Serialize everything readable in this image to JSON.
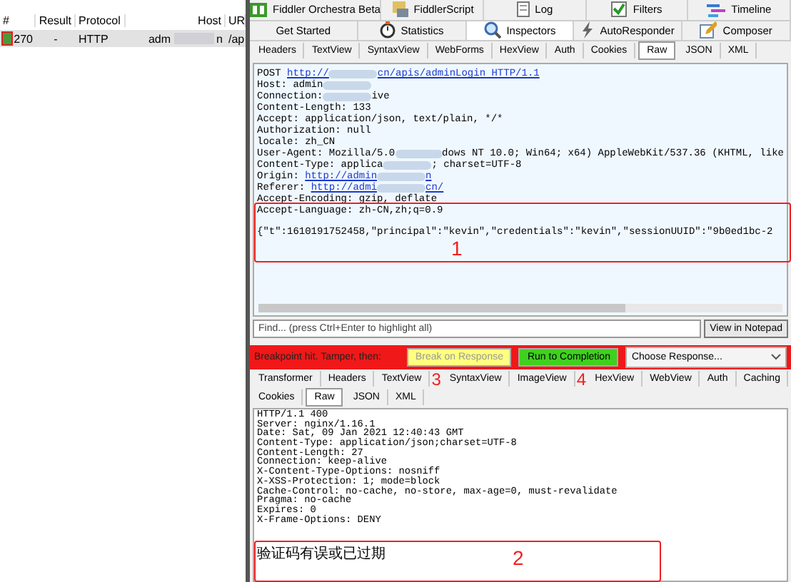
{
  "sessions": {
    "columns": [
      "#",
      "Result",
      "Protocol",
      "Host",
      "UR"
    ],
    "rows": [
      {
        "selected": true,
        "number": "270",
        "result": "-",
        "protocol": "HTTP",
        "host": [
          "adm",
          "n"
        ],
        "url": "/ap"
      }
    ]
  },
  "top_tabs": [
    [
      {
        "label": "Fiddler Orchestra Beta",
        "kind": "badge",
        "selected": false
      },
      {
        "label": "FiddlerScript",
        "kind": "script",
        "selected": false
      },
      {
        "label": "Log",
        "kind": "log",
        "selected": false
      },
      {
        "label": "Filters",
        "kind": "check",
        "selected": false
      },
      {
        "label": "Timeline",
        "kind": "timeline",
        "selected": false
      }
    ],
    [
      {
        "label": "Get Started",
        "kind": "plain",
        "selected": false
      },
      {
        "label": "Statistics",
        "kind": "stopwatch",
        "selected": false
      },
      {
        "label": "Inspectors",
        "kind": "magnifier",
        "selected": true
      },
      {
        "label": "AutoResponder",
        "kind": "bolt",
        "selected": false
      },
      {
        "label": "Composer",
        "kind": "pencil",
        "selected": false
      }
    ]
  ],
  "request_tabs": [
    {
      "label": "Headers",
      "selected": false
    },
    {
      "label": "TextView",
      "selected": false
    },
    {
      "label": "SyntaxView",
      "selected": false
    },
    {
      "label": "WebForms",
      "selected": false
    },
    {
      "label": "HexView",
      "selected": false
    },
    {
      "label": "Auth",
      "selected": false
    },
    {
      "label": "Cookies",
      "selected": false
    },
    {
      "label": "Raw",
      "selected": true
    },
    {
      "label": "JSON",
      "selected": false
    },
    {
      "label": "XML",
      "selected": false
    }
  ],
  "request": {
    "headers": [
      [
        {
          "kind": "text",
          "text": "POST "
        },
        {
          "kind": "link",
          "text": "http://"
        },
        {
          "kind": "redacted"
        },
        {
          "kind": "link",
          "text": "cn/apis/adminLogin HTTP/1.1"
        }
      ],
      [
        {
          "kind": "text",
          "text": "Host: admin"
        },
        {
          "kind": "redacted"
        }
      ],
      [
        {
          "kind": "text",
          "text": "Connection:"
        },
        {
          "kind": "redacted"
        },
        {
          "kind": "text",
          "text": "ive"
        }
      ],
      [
        {
          "kind": "text",
          "text": "Content-Length: 133"
        }
      ],
      [
        {
          "kind": "text",
          "text": "Accept: application/json, text/plain, */*"
        }
      ],
      [
        {
          "kind": "text",
          "text": "Authorization: null"
        }
      ],
      [
        {
          "kind": "text",
          "text": "locale: zh_CN"
        }
      ],
      [
        {
          "kind": "text",
          "text": "User-Agent: Mozilla/5.0"
        },
        {
          "kind": "redacted"
        },
        {
          "kind": "text",
          "text": "dows NT 10.0; Win64; x64) AppleWebKit/537.36 (KHTML, like"
        }
      ],
      [
        {
          "kind": "text",
          "text": "Content-Type: applica"
        },
        {
          "kind": "redacted"
        },
        {
          "kind": "text",
          "text": "; charset=UTF-8"
        }
      ],
      [
        {
          "kind": "text",
          "text": "Origin: "
        },
        {
          "kind": "link",
          "text": "http://admin"
        },
        {
          "kind": "redacted"
        },
        {
          "kind": "link",
          "text": "n"
        }
      ],
      [
        {
          "kind": "text",
          "text": "Referer: "
        },
        {
          "kind": "link",
          "text": "http://admi"
        },
        {
          "kind": "redacted"
        },
        {
          "kind": "link",
          "text": "cn/"
        }
      ],
      [
        {
          "kind": "text",
          "text": "Accept-Encoding: gzip, deflate"
        }
      ],
      [
        {
          "kind": "text",
          "text": "Accept-Language: zh-CN,zh;q=0.9"
        }
      ]
    ],
    "body": "{\"t\":1610191752458,\"principal\":\"kevin\",\"credentials\":\"kevin\",\"sessionUUID\":\"9b0ed1bc-2"
  },
  "find": {
    "placeholder": "Find... (press Ctrl+Enter to highlight all)",
    "button": "View in Notepad"
  },
  "breakpoint": {
    "message": "Breakpoint hit. Tamper, then:",
    "break_button": {
      "label": "Break on Response",
      "disabled": true
    },
    "run_button": "Run to Completion",
    "response_select": "Choose Response..."
  },
  "response_tabs": [
    [
      {
        "label": "Transformer",
        "selected": false
      },
      {
        "label": "Headers",
        "selected": false
      },
      {
        "label": "TextView",
        "selected": false
      },
      {
        "label": "SyntaxView",
        "selected": false
      },
      {
        "label": "ImageView",
        "selected": false
      },
      {
        "label": "HexView",
        "selected": false
      },
      {
        "label": "WebView",
        "selected": false
      },
      {
        "label": "Auth",
        "selected": false
      },
      {
        "label": "Caching",
        "selected": false
      }
    ],
    [
      {
        "label": "Cookies",
        "selected": false
      },
      {
        "label": "Raw",
        "selected": true
      },
      {
        "label": "JSON",
        "selected": false
      },
      {
        "label": "XML",
        "selected": false
      }
    ]
  ],
  "response": {
    "headers": [
      "HTTP/1.1 400",
      "Server: nginx/1.16.1",
      "Date: Sat, 09 Jan 2021 12:40:43 GMT",
      "Content-Type: application/json;charset=UTF-8",
      "Content-Length: 27",
      "Connection: keep-alive",
      "X-Content-Type-Options: nosniff",
      "X-XSS-Protection: 1; mode=block",
      "Cache-Control: no-cache, no-store, max-age=0, must-revalidate",
      "Pragma: no-cache",
      "Expires: 0",
      "X-Frame-Options: DENY"
    ],
    "body": "验证码有误或已过期"
  },
  "annotations": [
    {
      "label": "1"
    },
    {
      "label": "2"
    },
    {
      "label": "3"
    },
    {
      "label": "4"
    }
  ]
}
